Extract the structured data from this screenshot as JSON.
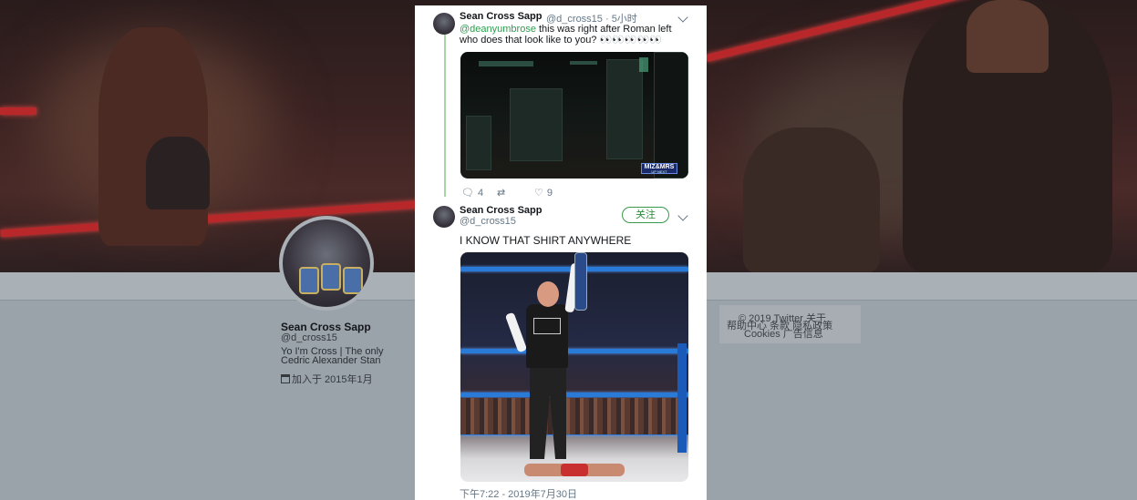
{
  "profile": {
    "name": "Sean Cross Sapp",
    "handle": "@d_cross15",
    "bio": "Yo I'm Cross | The only Cedric Alexander Stan",
    "joined": "加入于 2015年1月",
    "calendar_icon": "calendar-icon"
  },
  "footer": {
    "line1": "© 2019 Twitter  关于",
    "line2": "帮助中心  条款  隐私政策",
    "line3": "Cookies  广告信息"
  },
  "tweets": [
    {
      "name": "Sean Cross Sapp",
      "meta": "@d_cross15 · 5小时",
      "mention": "@deanyumbrose",
      "text": " this was right after Roman left who does that look like to you? 👀👀👀👀👀",
      "media_caption": "MIZ&MRS",
      "media_sub": "UP NEXT",
      "replies": "4",
      "retweets": "",
      "likes": "9"
    },
    {
      "name": "Sean Cross Sapp",
      "handle": "@d_cross15",
      "follow_label": "关注",
      "text": "I KNOW THAT SHIRT ANYWHERE",
      "timestamp": "下午7:22 - 2019年7月30日"
    }
  ],
  "icons": {
    "reply": "reply-icon",
    "retweet": "retweet-icon",
    "like": "heart-icon",
    "menu": "chevron-down-icon"
  },
  "colors": {
    "accent_green": "#2e9e4f",
    "thread_line": "#a8d5a6",
    "muted": "#657786"
  }
}
